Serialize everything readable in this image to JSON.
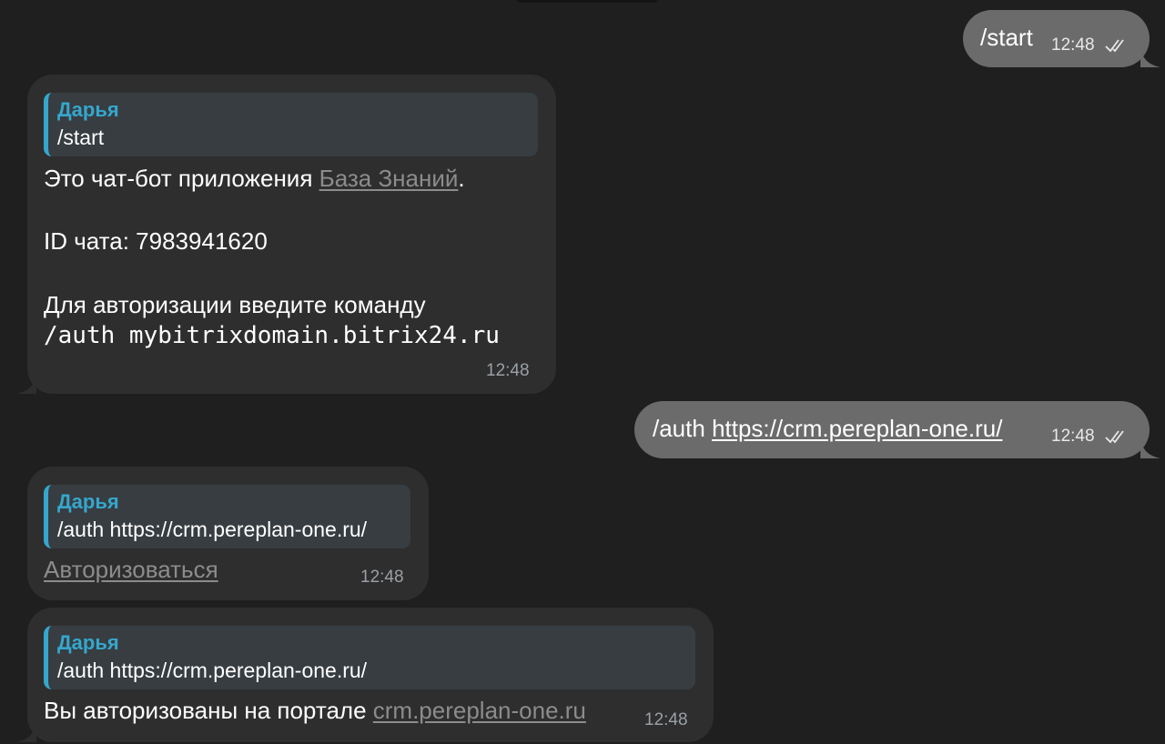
{
  "messages": {
    "m1": {
      "text": "/start",
      "time": "12:48",
      "status_icon": "double-check-icon"
    },
    "m2": {
      "reply_name": "Дарья",
      "reply_text": "/start",
      "line1_prefix": "Это чат-бот приложения ",
      "line1_link": "База Знаний",
      "line1_suffix": ".",
      "line2": "ID чата: 7983941620",
      "line3": "Для авторизации введите команду",
      "line4": "/auth mybitrixdomain.bitrix24.ru",
      "time": "12:48"
    },
    "m3": {
      "prefix": "/auth ",
      "link": "https://crm.pereplan-one.ru/",
      "time": "12:48",
      "status_icon": "double-check-icon"
    },
    "m4": {
      "reply_name": "Дарья",
      "reply_text": "/auth https://crm.pereplan-one.ru/",
      "action_link": "Авторизоваться",
      "time": "12:48"
    },
    "m5": {
      "reply_name": "Дарья",
      "reply_text": "/auth https://crm.pereplan-one.ru/",
      "prefix": "Вы авторизованы на портале ",
      "link": "crm.pereplan-one.ru",
      "time": "12:48"
    }
  },
  "colors": {
    "background": "#1f1f1f",
    "incoming_bubble": "#2e2e2e",
    "outgoing_bubble": "#6b6b6b",
    "reply_accent": "#35a7cd",
    "link_grey": "#8c8c8c"
  }
}
